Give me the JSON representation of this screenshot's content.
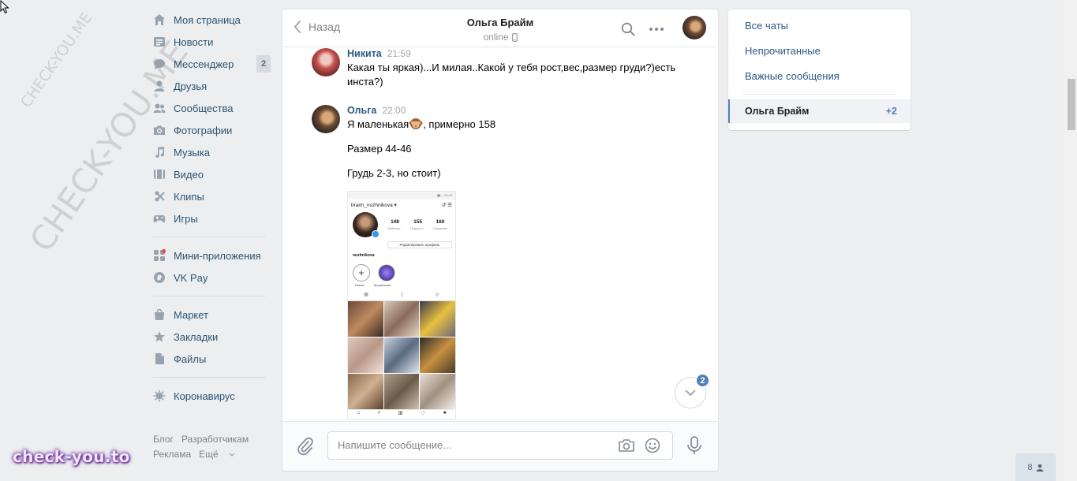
{
  "watermark": {
    "small": "CHECK-YOU.ME",
    "large": "CHECK-YOU.ME"
  },
  "brand": "check-you.to",
  "left_nav": {
    "items": [
      {
        "label": "Моя страница",
        "icon": "home-icon"
      },
      {
        "label": "Новости",
        "icon": "news-icon"
      },
      {
        "label": "Мессенджер",
        "icon": "messenger-icon",
        "badge": "2"
      },
      {
        "label": "Друзья",
        "icon": "friends-icon"
      },
      {
        "label": "Сообщества",
        "icon": "communities-icon"
      },
      {
        "label": "Фотографии",
        "icon": "camera-icon"
      },
      {
        "label": "Музыка",
        "icon": "music-icon"
      },
      {
        "label": "Видео",
        "icon": "video-icon"
      },
      {
        "label": "Клипы",
        "icon": "clips-icon"
      },
      {
        "label": "Игры",
        "icon": "games-icon"
      }
    ],
    "items2": [
      {
        "label": "Мини-приложения",
        "icon": "mini-apps-icon"
      },
      {
        "label": "VK Pay",
        "icon": "vkpay-icon"
      }
    ],
    "items3": [
      {
        "label": "Маркет",
        "icon": "market-icon"
      },
      {
        "label": "Закладки",
        "icon": "bookmark-icon"
      },
      {
        "label": "Файлы",
        "icon": "files-icon"
      }
    ],
    "items4": [
      {
        "label": "Коронавирус",
        "icon": "virus-icon"
      }
    ],
    "footer": {
      "blog": "Блог",
      "dev": "Разработчикам",
      "ads": "Реклама",
      "more": "Ещё"
    }
  },
  "chat": {
    "back_label": "Назад",
    "peer_name": "Ольга Брайм",
    "peer_status": "online",
    "messages": [
      {
        "author": "Никита",
        "time": "21:59",
        "text": "Какая ты яркая)...И милая..Какой у тебя рост,вес,размер груди?)есть инста?)"
      },
      {
        "author": "Ольга",
        "time": "22:00",
        "p1_before": "Я маленькая",
        "p1_after": ", примерно 158",
        "p2": "Размер 44-46",
        "p3": "Грудь 2-3, но стоит)"
      }
    ],
    "photo": {
      "status": "▮▮ ◔ 20:20",
      "username": "braim_nozhnikova ▾",
      "posts": "148",
      "posts_lbl": "Публика...",
      "followers": "155",
      "followers_lbl": "Подписч...",
      "following": "160",
      "following_lbl": "Подписки",
      "edit": "Редактировать профиль",
      "nick": "nozhnikova",
      "hl_new": "Новое",
      "hl_actual": "Актуальное"
    },
    "unread_count": "2",
    "composer_placeholder": "Напишите сообщение..."
  },
  "right_panel": {
    "all": "Все чаты",
    "unread": "Непрочитанные",
    "important": "Важные сообщения",
    "active_name": "Ольга Брайм",
    "active_count": "+2"
  },
  "online_friends": "8",
  "colors": {
    "accent": "#5181b8",
    "link": "#2a5885",
    "bg": "#edeef0"
  }
}
